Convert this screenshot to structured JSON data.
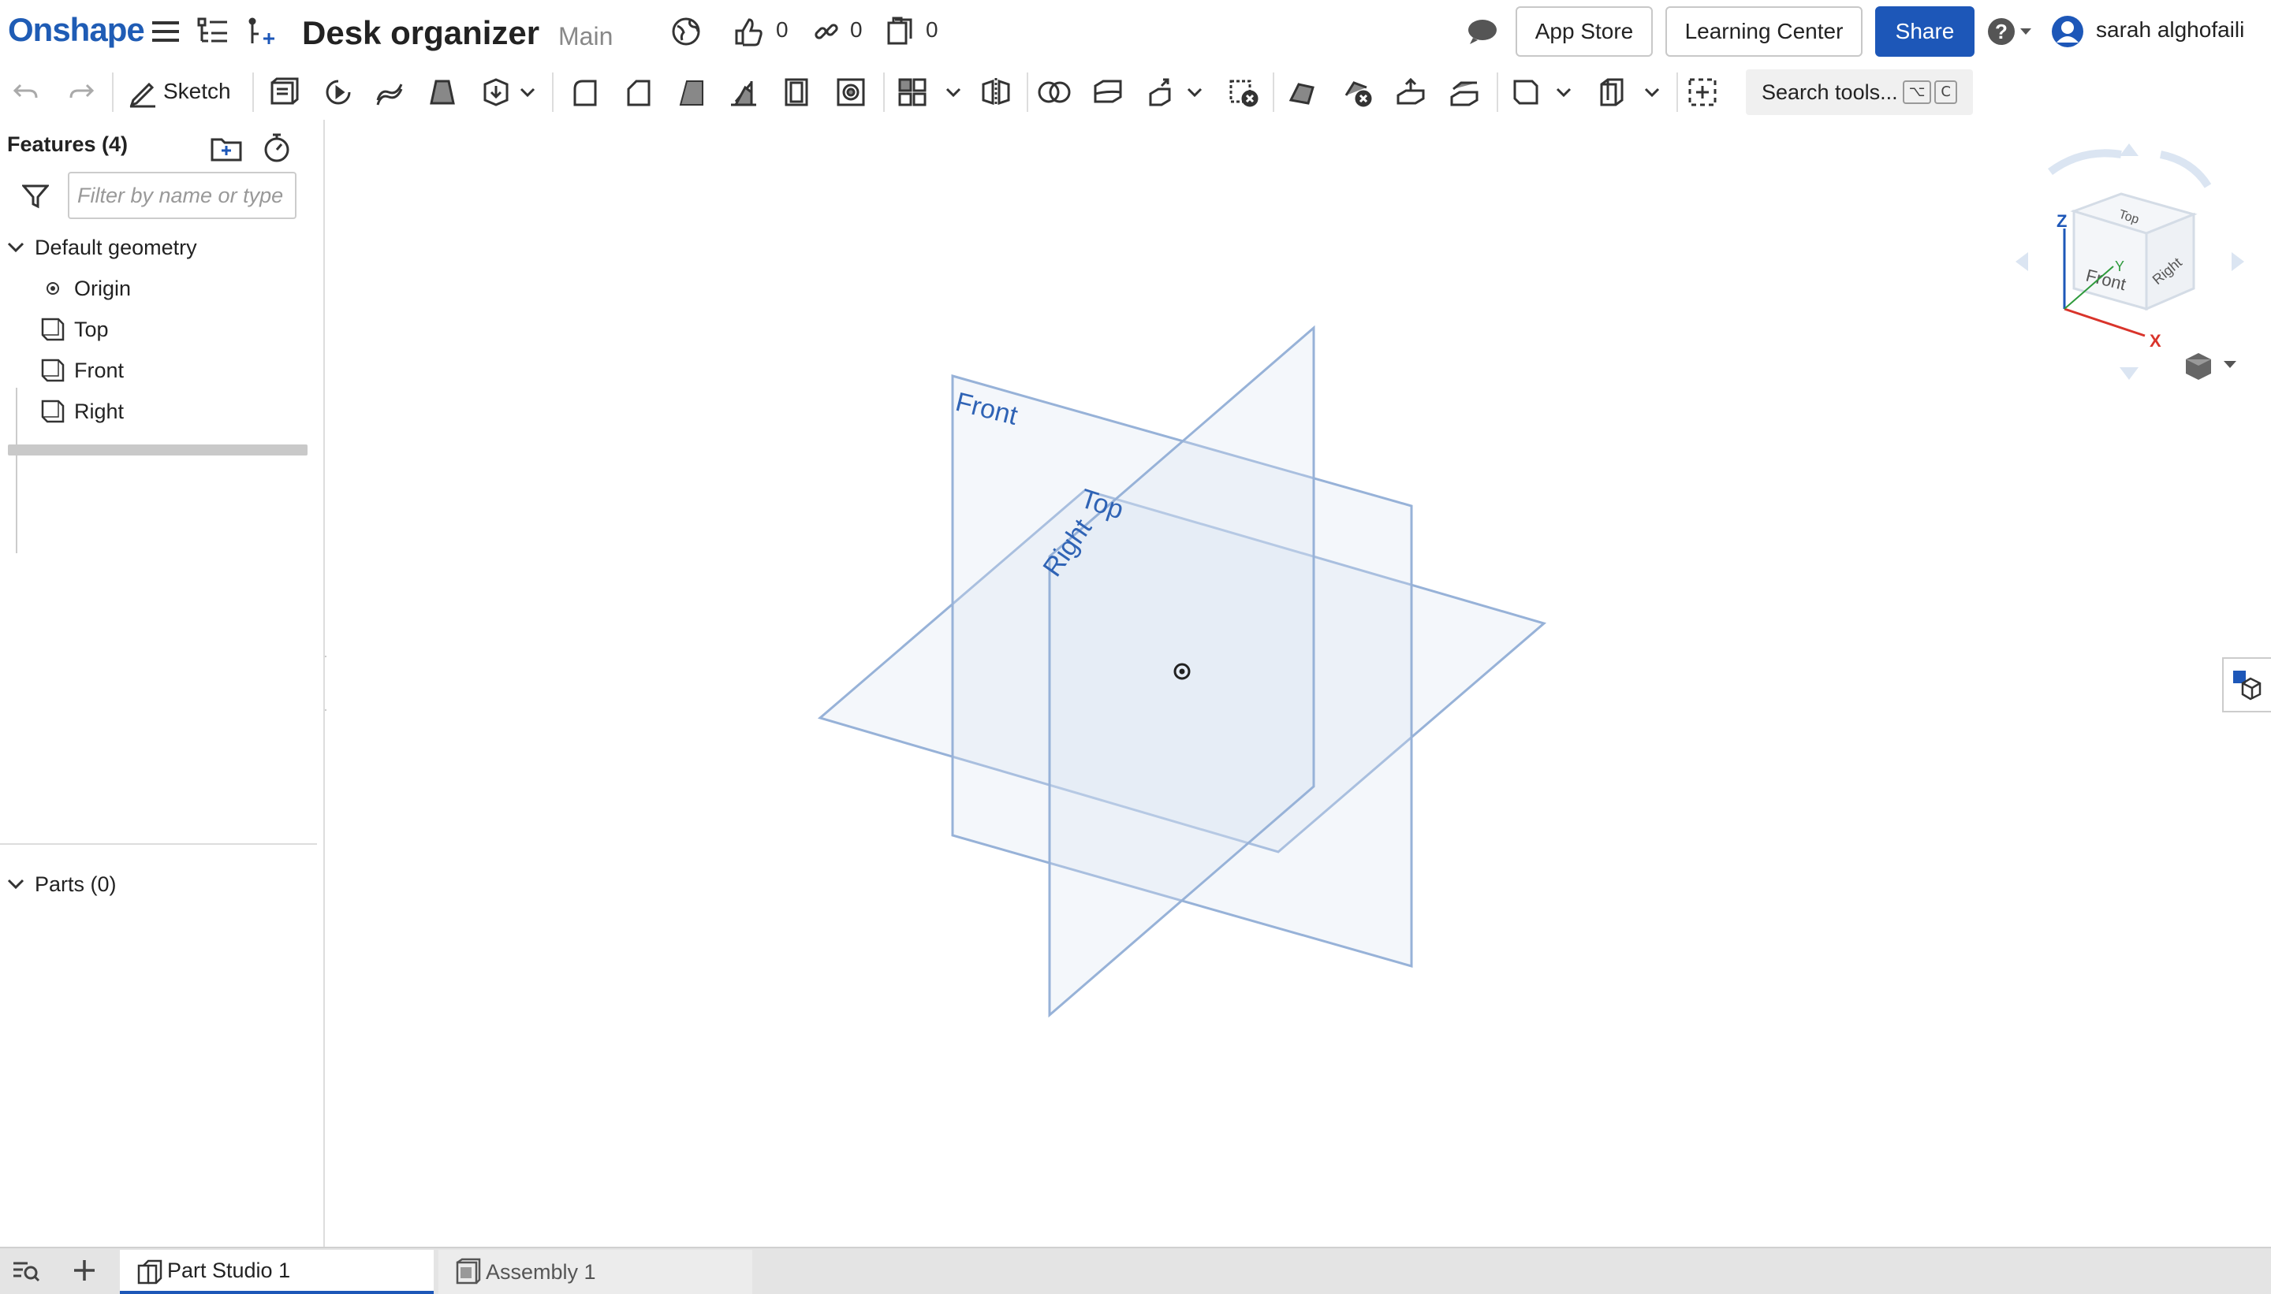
{
  "app": {
    "logo": "Onshape"
  },
  "document": {
    "title": "Desk organizer",
    "branch": "Main"
  },
  "stats": {
    "likes": "0",
    "links": "0",
    "copies": "0"
  },
  "header": {
    "app_store": "App Store",
    "learning_center": "Learning Center",
    "share": "Share",
    "user": "sarah alghofaili"
  },
  "toolbar": {
    "sketch": "Sketch",
    "search": "Search tools...",
    "search_kbd_1": "⌥",
    "search_kbd_2": "C"
  },
  "features": {
    "title": "Features (4)",
    "filter_placeholder": "Filter by name or type",
    "group": "Default geometry",
    "items": [
      {
        "label": "Origin",
        "icon": "origin-icon"
      },
      {
        "label": "Top",
        "icon": "plane-icon"
      },
      {
        "label": "Front",
        "icon": "plane-icon"
      },
      {
        "label": "Right",
        "icon": "plane-icon"
      }
    ]
  },
  "parts": {
    "title": "Parts (0)"
  },
  "viewport": {
    "planes": {
      "front": "Front",
      "top": "Top",
      "right": "Right"
    },
    "view_cube": {
      "top": "Top",
      "front": "Front",
      "right": "Right",
      "x": "X",
      "y": "Y",
      "z": "Z"
    }
  },
  "tabs": [
    {
      "label": "Part Studio 1",
      "active": true
    },
    {
      "label": "Assembly 1",
      "active": false
    }
  ],
  "colors": {
    "brand": "#1f5cb5",
    "share": "#1d57b8",
    "plane_stroke": "#97b2d8",
    "plane_label": "#2f63b5"
  }
}
